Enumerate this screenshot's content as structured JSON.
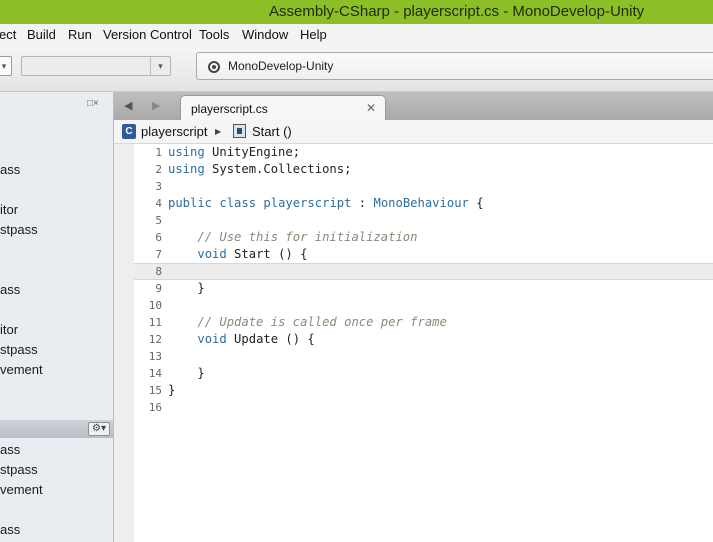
{
  "window": {
    "title": "Assembly-CSharp - playerscript.cs - MonoDevelop-Unity"
  },
  "menu": {
    "items": [
      "ect",
      "Build",
      "Run",
      "Version Control",
      "Tools",
      "Window",
      "Help"
    ]
  },
  "toolbar": {
    "config_value": "",
    "status_text": "MonoDevelop-Unity"
  },
  "left_panel": {
    "upper_items": [
      "ass",
      "itor",
      "stpass",
      "ass",
      "itor",
      "stpass",
      "vement"
    ],
    "lower_items": [
      "ass",
      "stpass",
      "vement",
      "ass"
    ],
    "panel_buttons": "□×"
  },
  "editor": {
    "tab": {
      "label": "playerscript.cs"
    },
    "breadcrumb": {
      "class_icon_letter": "C",
      "class_name": "playerscript",
      "method_name": "Start ()"
    },
    "current_line": 8,
    "lines": [
      {
        "n": "1",
        "tokens": [
          {
            "t": "kw",
            "v": "using"
          },
          {
            "t": "pl",
            "v": " UnityEngine;"
          }
        ]
      },
      {
        "n": "2",
        "tokens": [
          {
            "t": "kw",
            "v": "using"
          },
          {
            "t": "pl",
            "v": " System.Collections;"
          }
        ]
      },
      {
        "n": "3",
        "tokens": []
      },
      {
        "n": "4",
        "tokens": [
          {
            "t": "kw",
            "v": "public class"
          },
          {
            "t": "pl",
            "v": " "
          },
          {
            "t": "ty",
            "v": "playerscript"
          },
          {
            "t": "pl",
            "v": " : "
          },
          {
            "t": "ty",
            "v": "MonoBehaviour"
          },
          {
            "t": "pl",
            "v": " {"
          }
        ]
      },
      {
        "n": "5",
        "tokens": []
      },
      {
        "n": "6",
        "tokens": [
          {
            "t": "pl",
            "v": "    "
          },
          {
            "t": "cm",
            "v": "// Use this for initialization"
          }
        ]
      },
      {
        "n": "7",
        "tokens": [
          {
            "t": "pl",
            "v": "    "
          },
          {
            "t": "kw",
            "v": "void"
          },
          {
            "t": "pl",
            "v": " Start () {"
          }
        ]
      },
      {
        "n": "8",
        "tokens": []
      },
      {
        "n": "9",
        "tokens": [
          {
            "t": "pl",
            "v": "    }"
          }
        ]
      },
      {
        "n": "10",
        "tokens": []
      },
      {
        "n": "11",
        "tokens": [
          {
            "t": "pl",
            "v": "    "
          },
          {
            "t": "cm",
            "v": "// Update is called once per frame"
          }
        ]
      },
      {
        "n": "12",
        "tokens": [
          {
            "t": "pl",
            "v": "    "
          },
          {
            "t": "kw",
            "v": "void"
          },
          {
            "t": "pl",
            "v": " Update () {"
          }
        ]
      },
      {
        "n": "13",
        "tokens": []
      },
      {
        "n": "14",
        "tokens": [
          {
            "t": "pl",
            "v": "    }"
          }
        ]
      },
      {
        "n": "15",
        "tokens": [
          {
            "t": "pl",
            "v": "}"
          }
        ]
      },
      {
        "n": "16",
        "tokens": []
      }
    ]
  },
  "colors": {
    "titlebar": "#8cbf26",
    "keyword": "#2d6ea0",
    "comment": "#8a8a7a"
  }
}
